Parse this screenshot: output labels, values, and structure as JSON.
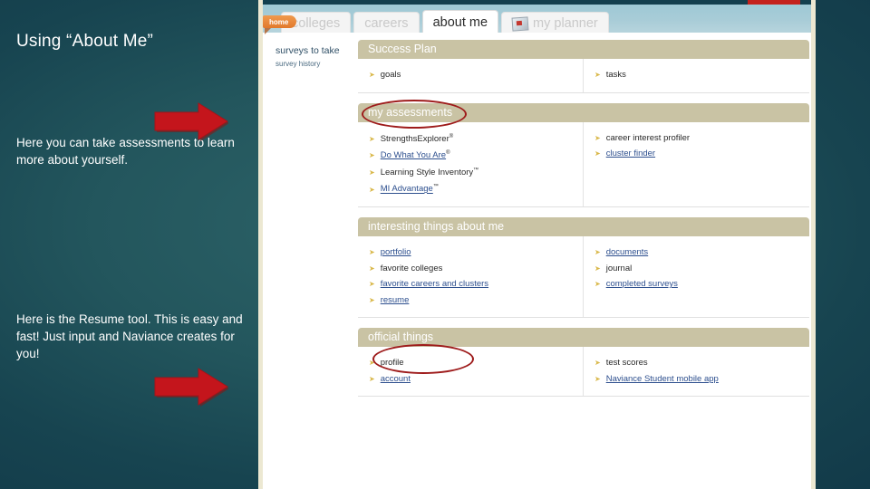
{
  "slide": {
    "title": "Using “About Me”",
    "note_1": "Here you can take assessments to learn more about yourself.",
    "note_2": "Here is the Resume tool.  This is easy and fast! Just input and Naviance creates for you!",
    "arrow_color": "#c4151c",
    "background_color": "#1d4f59"
  },
  "app": {
    "tabs": [
      {
        "label": "colleges",
        "active": false,
        "icon": null
      },
      {
        "label": "careers",
        "active": false,
        "icon": null
      },
      {
        "label": "about me",
        "active": true,
        "icon": null
      },
      {
        "label": "my planner",
        "active": false,
        "icon": "calendar-picture-icon"
      }
    ],
    "home_badge": "home",
    "sidebar": {
      "main": "surveys to take",
      "sub": "survey history"
    },
    "panels": [
      {
        "title": "Success Plan",
        "left": [
          {
            "label": "goals",
            "visited": false
          }
        ],
        "right": [
          {
            "label": "tasks",
            "visited": false
          }
        ]
      },
      {
        "title": "my assessments",
        "circled": true,
        "left": [
          {
            "label": "StrengthsExplorer",
            "sup": "®",
            "visited": false
          },
          {
            "label": "Do What You Are",
            "sup": "®",
            "visited": true
          },
          {
            "label": "Learning Style Inventory",
            "sup": "™",
            "visited": false
          },
          {
            "label": "MI Advantage",
            "sup": "™",
            "visited": true
          }
        ],
        "right": [
          {
            "label": "career interest profiler",
            "visited": false
          },
          {
            "label": "cluster finder",
            "visited": true
          }
        ]
      },
      {
        "title": "interesting things about me",
        "left": [
          {
            "label": "portfolio",
            "visited": true
          },
          {
            "label": "favorite colleges",
            "visited": false
          },
          {
            "label": "favorite careers and clusters",
            "visited": true
          },
          {
            "label": "resume",
            "visited": true,
            "circled": true
          }
        ],
        "right": [
          {
            "label": "documents",
            "visited": true
          },
          {
            "label": "journal",
            "visited": false
          },
          {
            "label": "completed surveys",
            "visited": true
          }
        ]
      },
      {
        "title": "official things",
        "left": [
          {
            "label": "profile",
            "visited": false
          },
          {
            "label": "account",
            "visited": true
          }
        ],
        "right": [
          {
            "label": "test scores",
            "visited": false
          },
          {
            "label": "Naviance Student mobile app",
            "visited": true
          }
        ]
      }
    ],
    "colors": {
      "panel_header": "#c9c3a4",
      "tab_strip": "#a8ccd7",
      "home_badge": "#e2792b",
      "annotation": "#9e1b1b",
      "top_band": "#c4221d"
    }
  }
}
